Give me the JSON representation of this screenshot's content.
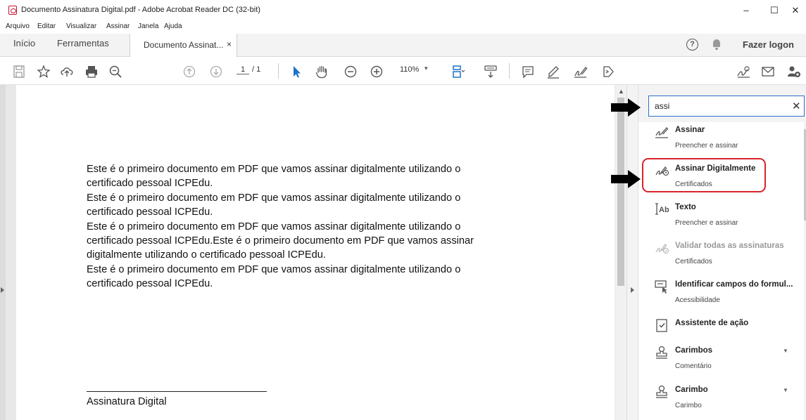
{
  "window": {
    "title": "Documento Assinatura Digital.pdf - Adobe Acrobat Reader DC (32-bit)",
    "controls": [
      "–",
      "☐",
      "✕"
    ]
  },
  "menu": [
    "Arquivo",
    "Editar",
    "Visualizar",
    "Assinar",
    "Janela",
    "Ajuda"
  ],
  "tabs": {
    "home": "Início",
    "tools": "Ferramentas",
    "document": "Documento Assinat...",
    "document_close": "×",
    "help": "?",
    "login": "Fazer logon"
  },
  "toolbar": {
    "page_current": "1",
    "page_total": "/ 1",
    "zoom": "110%",
    "zoom_caret": "▾"
  },
  "document": {
    "lines": [
      "Este é o primeiro documento em PDF que vamos assinar digitalmente utilizando o",
      "certificado pessoal ICPEdu.",
      "Este é o primeiro documento em PDF que vamos assinar digitalmente utilizando o",
      "certificado pessoal ICPEdu.",
      "Este é o primeiro documento em PDF que vamos assinar digitalmente utilizando o",
      "certificado pessoal ICPEdu.Este é o primeiro documento em PDF que vamos assinar",
      "digitalmente utilizando o certificado pessoal ICPEdu.",
      "Este é o primeiro documento em PDF que vamos assinar digitalmente utilizando o",
      "certificado pessoal ICPEdu."
    ],
    "signature_line": "______________________________",
    "signature_label": "Assinatura Digital"
  },
  "search": {
    "value": "assi",
    "clear": "✕"
  },
  "results": [
    {
      "name": "Assinar",
      "sub": "Preencher e assinar",
      "icon": "sign-pen-icon"
    },
    {
      "name": "Assinar Digitalmente",
      "sub": "Certificados",
      "icon": "digital-sign-pen-icon"
    },
    {
      "name": "Texto",
      "sub": "Preencher e assinar",
      "icon": "text-field-icon"
    },
    {
      "name": "Validar todas as assinaturas",
      "sub": "Certificados",
      "icon": "validate-signature-icon"
    },
    {
      "name": "Identificar campos do formul...",
      "sub": "Acessibilidade",
      "icon": "identify-fields-icon"
    },
    {
      "name": "Assistente de ação",
      "sub": "",
      "icon": "action-wizard-icon"
    },
    {
      "name": "Carimbos",
      "sub": "Comentário",
      "icon": "stamp-icon"
    },
    {
      "name": "Carimbo",
      "sub": "Carimbo",
      "icon": "stamp-icon"
    }
  ],
  "colors": {
    "accent_blue": "#2d6ec9",
    "highlight_red": "#d8232a",
    "toolbar_icon": "#555555",
    "pointer_blue": "#1a73c8"
  }
}
